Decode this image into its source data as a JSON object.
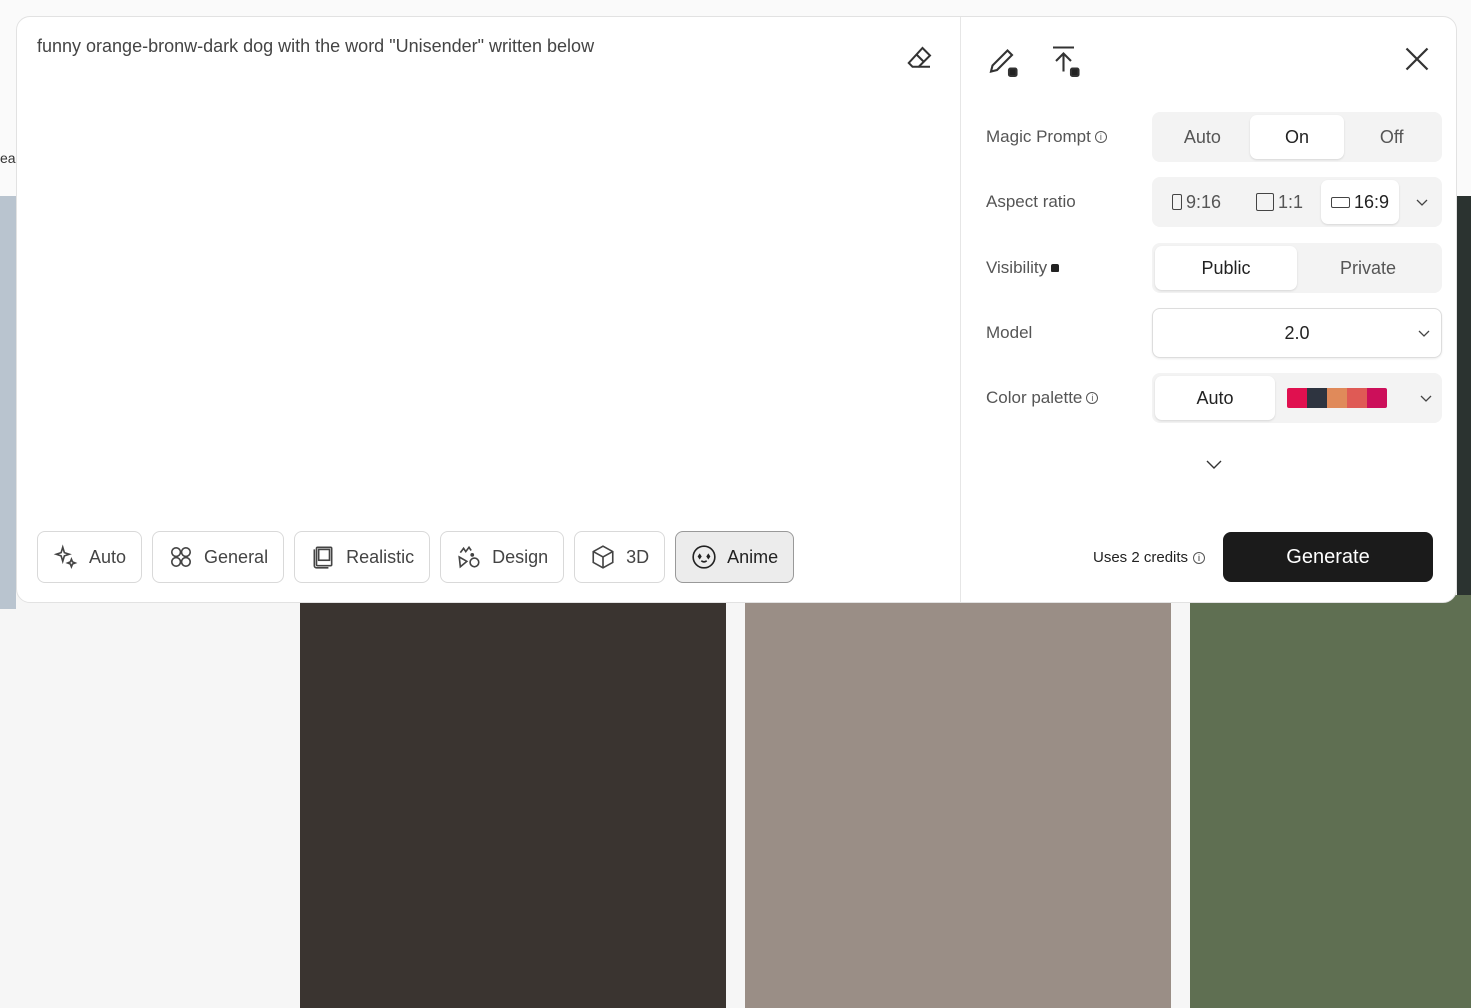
{
  "background": {
    "edge_text": "ea"
  },
  "prompt": {
    "text": "funny orange-bronw-dark dog with the word \"Unisender\" written below"
  },
  "styles": [
    {
      "label": "Auto",
      "icon": "sparkle-icon"
    },
    {
      "label": "General",
      "icon": "grid-icon"
    },
    {
      "label": "Realistic",
      "icon": "photos-icon"
    },
    {
      "label": "Design",
      "icon": "shapes-icon"
    },
    {
      "label": "3D",
      "icon": "cube-icon"
    },
    {
      "label": "Anime",
      "icon": "anime-face-icon",
      "selected": true
    }
  ],
  "settings": {
    "magic_prompt": {
      "label": "Magic Prompt",
      "options": [
        "Auto",
        "On",
        "Off"
      ],
      "selected": "On"
    },
    "aspect_ratio": {
      "label": "Aspect ratio",
      "options": [
        "9:16",
        "1:1",
        "16:9"
      ],
      "selected": "16:9"
    },
    "visibility": {
      "label": "Visibility",
      "options": [
        "Public",
        "Private"
      ],
      "selected": "Public"
    },
    "model": {
      "label": "Model",
      "value": "2.0"
    },
    "color_palette": {
      "label": "Color palette",
      "value": "Auto",
      "colors": [
        "#e0104f",
        "#2e3440",
        "#e08a5a",
        "#df5a55",
        "#cc0f5a"
      ]
    }
  },
  "footer": {
    "credits": "Uses 2 credits",
    "generate": "Generate"
  }
}
